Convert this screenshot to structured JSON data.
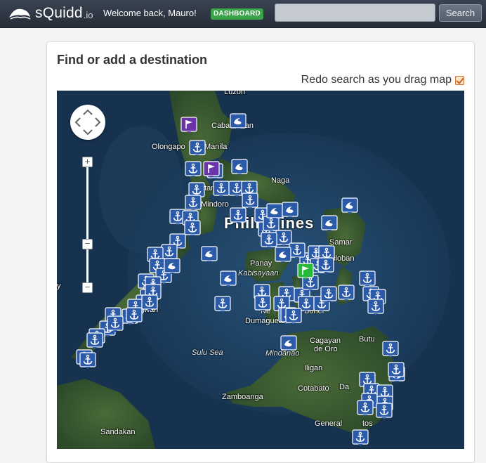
{
  "header": {
    "logo_text": "sQuidd",
    "logo_tld": ".io",
    "welcome": "Welcome back, Mauro!",
    "dashboard_badge": "DASHBOARD",
    "search_placeholder": "",
    "search_button": "Search"
  },
  "panel": {
    "title": "Find or add a destination",
    "redo_label": "Redo search as you drag map",
    "redo_checked": true
  },
  "map": {
    "controls": {
      "zoom_in": "+",
      "zoom_out": "−",
      "zoom_mid": "−"
    },
    "labels": {
      "luzon": "Luzon",
      "cabanatuan": "Cabanatuan",
      "olongapo": "Olongapo",
      "manila": "Manila",
      "batangas": "atangas",
      "mindoro": "Mindoro",
      "naga": "Naga",
      "philippines": "Philippines",
      "samar": "Samar",
      "panay": "Panay",
      "kabisayaan": "Kabisayaan",
      "tacloban": "acloban",
      "negros": "Ne",
      "bohol": "Bohol",
      "dumaguete": "Dumaguete",
      "palawan": "awan",
      "sulu_sea": "Sulu Sea",
      "mindanao": "Mindanao",
      "cagayan": "Cagayan",
      "de_oro": "de Oro",
      "butuan": "Butu",
      "iligan": "Iligan",
      "cotabato": "Cotabato",
      "davao": "Da",
      "zamboanga": "Zamboanga",
      "sandakan": "Sandakan",
      "general_santos": "General",
      "general_santos_2": "tos",
      "left_edge": "y"
    },
    "colors": {
      "marker": "#2a5aa8",
      "marker_border": "#ffffff",
      "flag_purple": "#6a35a8",
      "flag_green": "#28b83a"
    }
  }
}
